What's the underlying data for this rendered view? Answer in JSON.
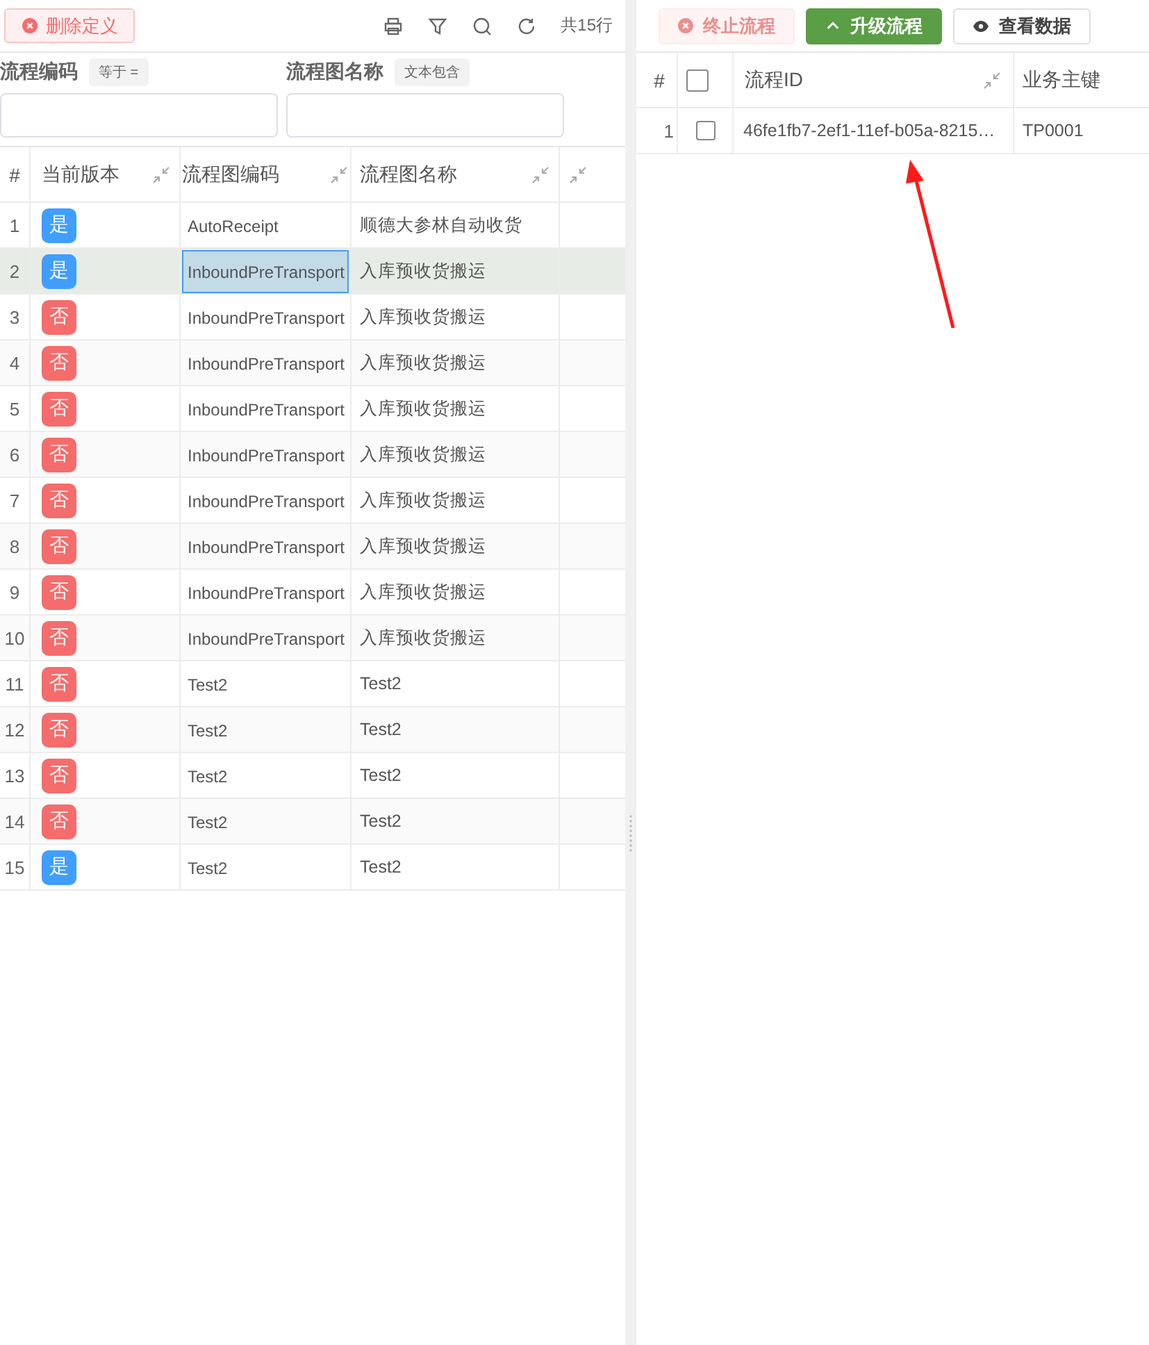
{
  "left": {
    "delete_button": {
      "label": "删除定义",
      "disabled": false
    },
    "total": "共15行",
    "filters": [
      {
        "label": "流程编码",
        "operator": "等于 ="
      },
      {
        "label": "流程图名称",
        "operator": "文本包含"
      }
    ],
    "table": {
      "columns": [
        "#",
        "当前版本",
        "流程图编码",
        "流程图名称"
      ],
      "rows": [
        {
          "index": "1",
          "current": true,
          "badge": "是",
          "code": "AutoReceipt",
          "name": "顺德大参林自动收货",
          "selected": false
        },
        {
          "index": "2",
          "current": true,
          "badge": "是",
          "code": "InboundPreTransport",
          "name": "入库预收货搬运",
          "selected": true
        },
        {
          "index": "3",
          "current": false,
          "badge": "否",
          "code": "InboundPreTransport",
          "name": "入库预收货搬运",
          "selected": false
        },
        {
          "index": "4",
          "current": false,
          "badge": "否",
          "code": "InboundPreTransport",
          "name": "入库预收货搬运",
          "selected": false
        },
        {
          "index": "5",
          "current": false,
          "badge": "否",
          "code": "InboundPreTransport",
          "name": "入库预收货搬运",
          "selected": false
        },
        {
          "index": "6",
          "current": false,
          "badge": "否",
          "code": "InboundPreTransport",
          "name": "入库预收货搬运",
          "selected": false
        },
        {
          "index": "7",
          "current": false,
          "badge": "否",
          "code": "InboundPreTransport",
          "name": "入库预收货搬运",
          "selected": false
        },
        {
          "index": "8",
          "current": false,
          "badge": "否",
          "code": "InboundPreTransport",
          "name": "入库预收货搬运",
          "selected": false
        },
        {
          "index": "9",
          "current": false,
          "badge": "否",
          "code": "InboundPreTransport",
          "name": "入库预收货搬运",
          "selected": false
        },
        {
          "index": "10",
          "current": false,
          "badge": "否",
          "code": "InboundPreTransport",
          "name": "入库预收货搬运",
          "selected": false
        },
        {
          "index": "11",
          "current": false,
          "badge": "否",
          "code": "Test2",
          "name": "Test2",
          "selected": false
        },
        {
          "index": "12",
          "current": false,
          "badge": "否",
          "code": "Test2",
          "name": "Test2",
          "selected": false
        },
        {
          "index": "13",
          "current": false,
          "badge": "否",
          "code": "Test2",
          "name": "Test2",
          "selected": false
        },
        {
          "index": "14",
          "current": false,
          "badge": "否",
          "code": "Test2",
          "name": "Test2",
          "selected": false
        },
        {
          "index": "15",
          "current": true,
          "badge": "是",
          "code": "Test2",
          "name": "Test2",
          "selected": false
        }
      ]
    }
  },
  "right": {
    "buttons": [
      {
        "kind": "stop",
        "label": "终止流程",
        "disabled": true
      },
      {
        "kind": "upgrade",
        "label": "升级流程",
        "disabled": false
      },
      {
        "kind": "view",
        "label": "查看数据",
        "disabled": false
      }
    ],
    "table": {
      "columns": [
        "#",
        "流程ID",
        "业务主键"
      ],
      "select_all_checked": false,
      "rows": [
        {
          "index": "1",
          "checked": false,
          "id": "46fe1fb7-2ef1-11ef-b05a-8215…",
          "key": "TP0001"
        }
      ]
    }
  }
}
